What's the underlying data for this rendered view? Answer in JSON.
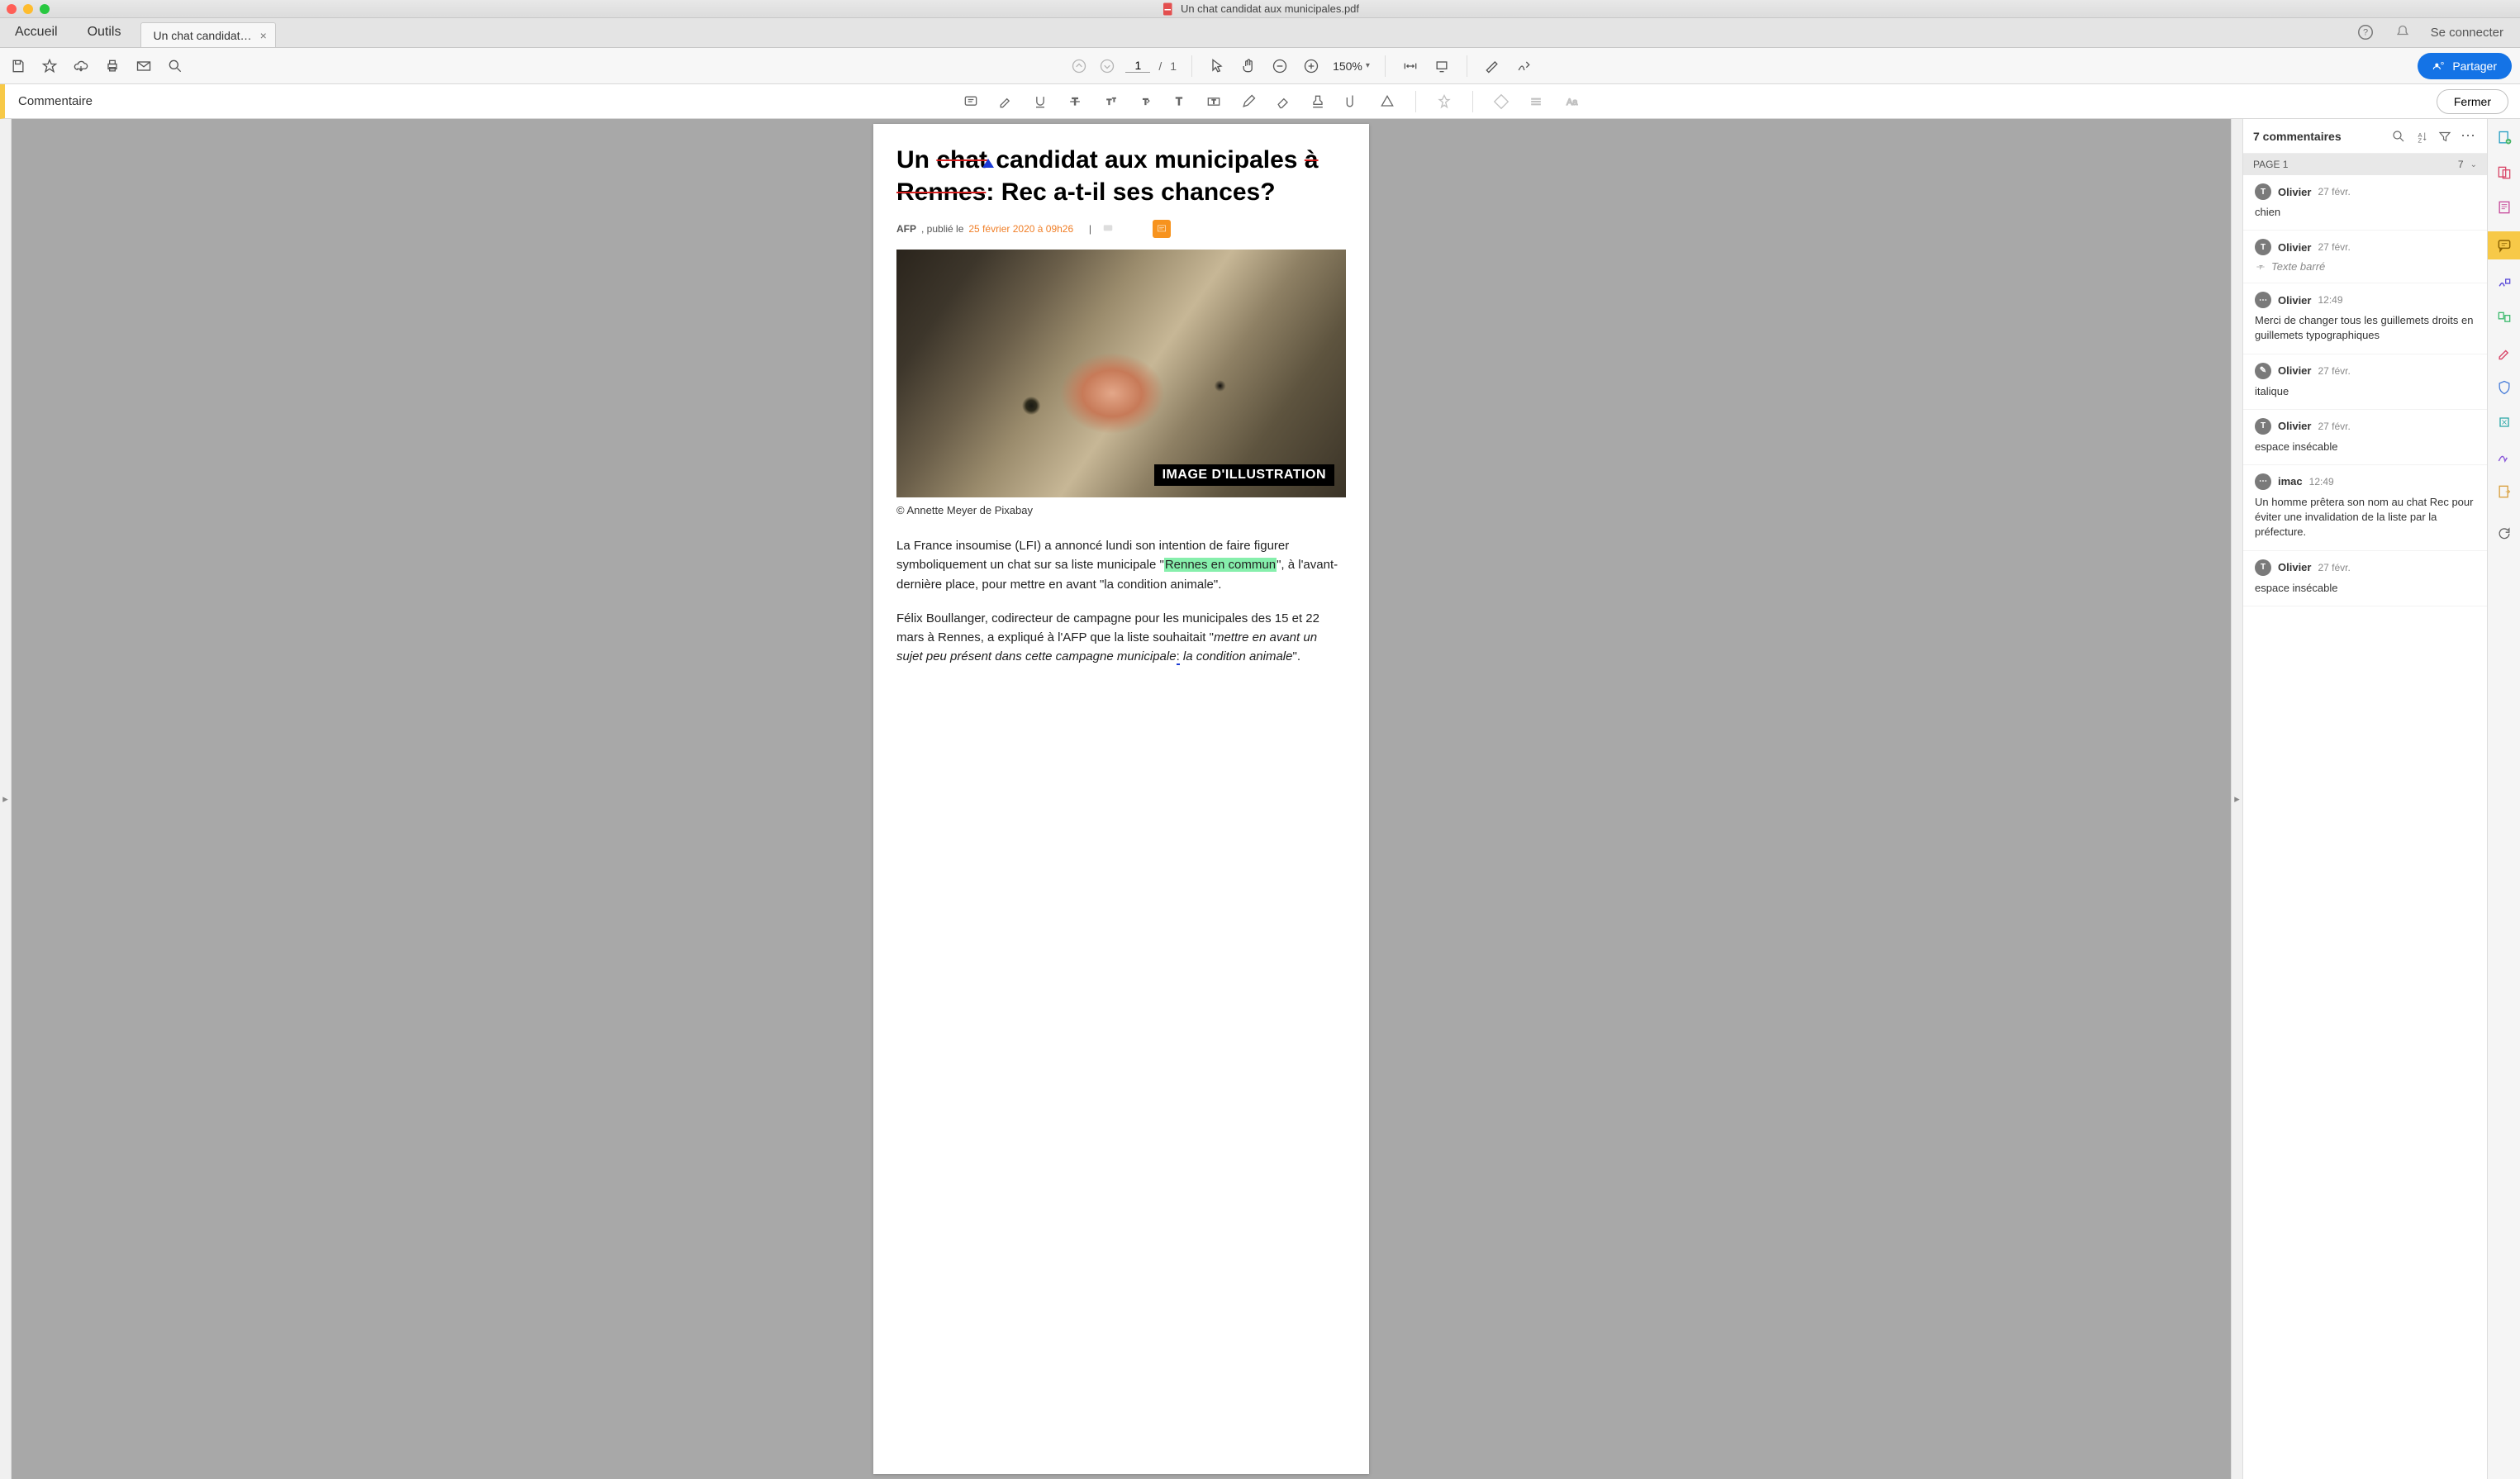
{
  "titlebar": {
    "filename": "Un chat candidat aux municipales.pdf"
  },
  "tabs": {
    "home": "Accueil",
    "tools": "Outils",
    "doc": "Un chat candidat…",
    "help": "?",
    "signin": "Se connecter"
  },
  "toolbar": {
    "page_current": "1",
    "page_sep": "/",
    "page_total": "1",
    "zoom": "150%",
    "share": "Partager"
  },
  "comment_bar": {
    "label": "Commentaire",
    "close": "Fermer"
  },
  "document": {
    "h1_a": "Un ",
    "h1_b_strike": "chat",
    "h1_c": " candidat aux municipales ",
    "h1_d_strike": "à Rennes",
    "h1_e": ": Rec a-t-il ses chances?",
    "meta_afp": "AFP",
    "meta_pub": ", publié le ",
    "meta_date": "25 février 2020 à 09h26",
    "meta_sep": "|",
    "photo_label": "IMAGE D'ILLUSTRATION",
    "caption": "© Annette Meyer de Pixabay",
    "p1_a": "La France insoumise (LFI) a annoncé lundi son intention de faire figurer symboliquement un chat sur sa liste municipale \"",
    "p1_hl": "Rennes en commun",
    "p1_b": "\", à l'avant-dernière place, pour mettre en avant \"la condition animale\".",
    "p2_a": "Félix Boullanger, codirecteur de campagne pour les municipales des 15 et 22 mars à Rennes, a expliqué à l'AFP que la liste souhaitait \"",
    "p2_q": "mettre en avant un sujet peu présent dans cette campagne municipale",
    "p2_ins": ":",
    "p2_c": " la condition animale",
    "p2_d": "\"."
  },
  "comments": {
    "header": "7 commentaires",
    "page_label": "PAGE 1",
    "page_count": "7",
    "items": [
      {
        "avatar": "T",
        "author": "Olivier",
        "ts": "27 févr.",
        "text": "chien",
        "barre": false
      },
      {
        "avatar": "T",
        "author": "Olivier",
        "ts": "27 févr.",
        "text": "Texte barré",
        "barre": true
      },
      {
        "avatar": "⋯",
        "author": "Olivier",
        "ts": "12:49",
        "text": "Merci de changer tous les guillemets droits en guillemets typographiques",
        "barre": false
      },
      {
        "avatar": "✎",
        "author": "Olivier",
        "ts": "27 févr.",
        "text": "italique",
        "barre": false
      },
      {
        "avatar": "T",
        "author": "Olivier",
        "ts": "27 févr.",
        "text": "espace insécable",
        "barre": false
      },
      {
        "avatar": "⋯",
        "author": "imac",
        "ts": "12:49",
        "text": "Un homme prêtera son nom au chat Rec pour éviter une invalidation de la liste par la préfecture.",
        "barre": false
      },
      {
        "avatar": "T",
        "author": "Olivier",
        "ts": "27 févr.",
        "text": "espace insécable",
        "barre": false
      }
    ]
  }
}
